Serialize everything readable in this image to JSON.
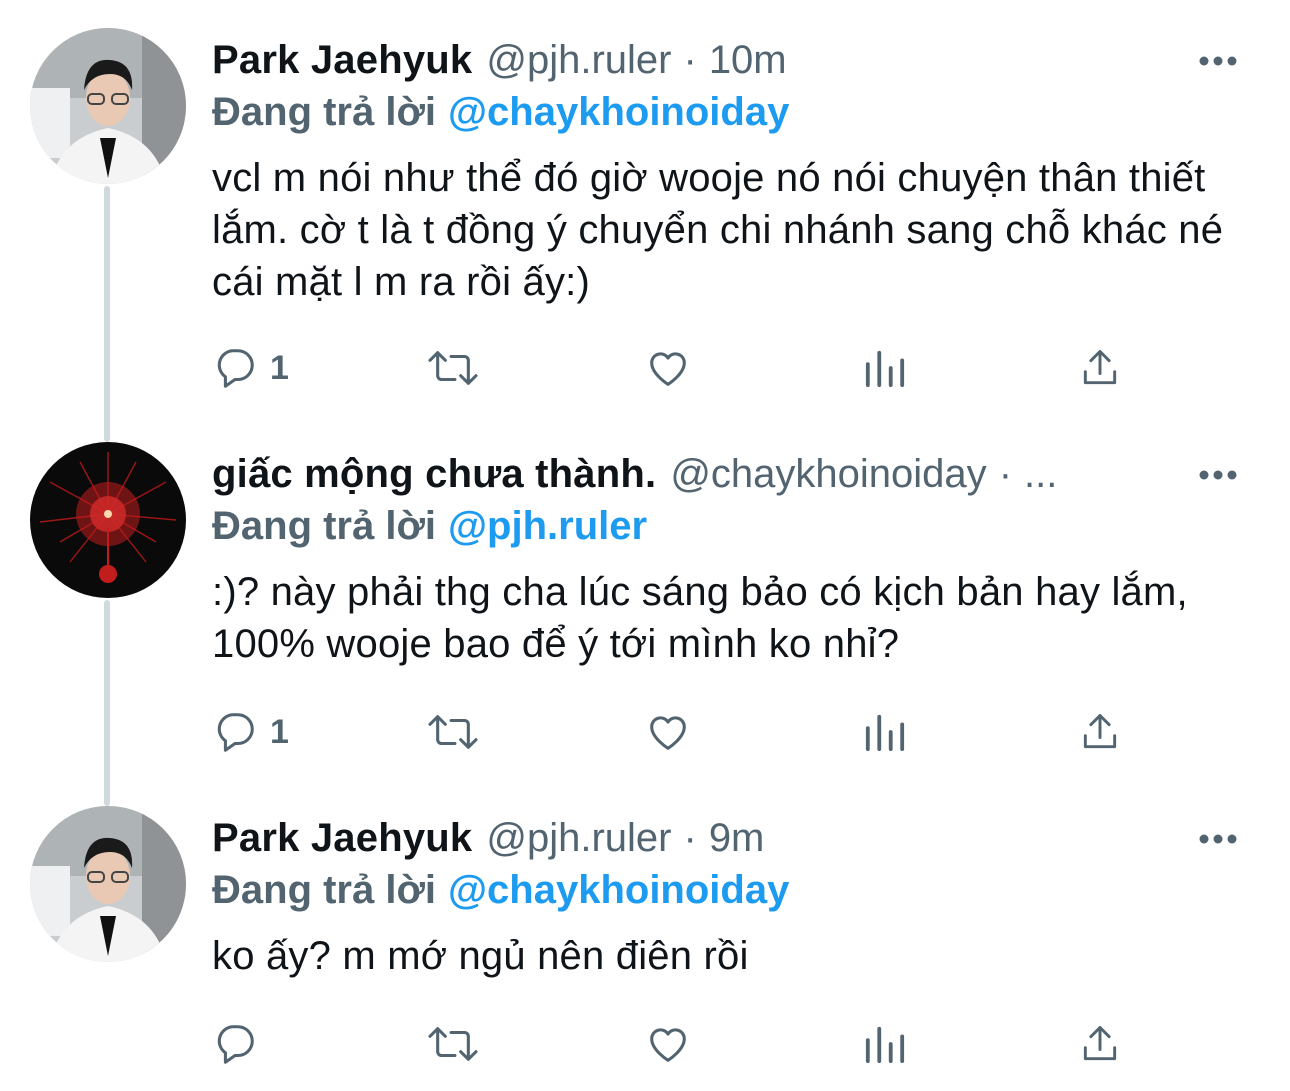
{
  "thread": {
    "tweets": [
      {
        "display_name": "Park Jaehyuk",
        "handle": "@pjh.ruler",
        "separator": "·",
        "time": "10m",
        "reply_prefix": "Đang trả lời",
        "reply_to": "@chaykhoinoiday",
        "text": "vcl m nói như thể đó giờ wooje nó nói chuyện thân thiết lắm. cờ t là t đồng ý chuyển chi nhánh sang chỗ khác né cái mặt l m ra rồi ấy:)",
        "reply_count": "1",
        "avatar_icon": "portrait-photo"
      },
      {
        "display_name": "giấc mộng chưa thành.",
        "handle": "@chaykhoinoiday",
        "separator": "·",
        "time": "...",
        "reply_prefix": "Đang trả lời",
        "reply_to": "@pjh.ruler",
        "text": ":)? này phải thg cha lúc sáng bảo có kịch bản hay lắm, 100% wooje bao để ý tới mình ko nhỉ?",
        "reply_count": "1",
        "avatar_icon": "red-burst-image"
      },
      {
        "display_name": "Park Jaehyuk",
        "handle": "@pjh.ruler",
        "separator": "·",
        "time": "9m",
        "reply_prefix": "Đang trả lời",
        "reply_to": "@chaykhoinoiday",
        "text": "ko ấy? m mớ ngủ nên điên rồi",
        "reply_count": "",
        "avatar_icon": "portrait-photo"
      }
    ]
  },
  "icons": {
    "reply": "speech-bubble-icon",
    "retweet": "retweet-icon",
    "like": "heart-icon",
    "views": "bar-chart-icon",
    "share": "share-icon",
    "more": "more-dots-icon"
  },
  "colors": {
    "text_primary": "#0f1419",
    "text_secondary": "#536471",
    "link_blue": "#1d9bf0",
    "thread_line": "#cfd9de"
  }
}
